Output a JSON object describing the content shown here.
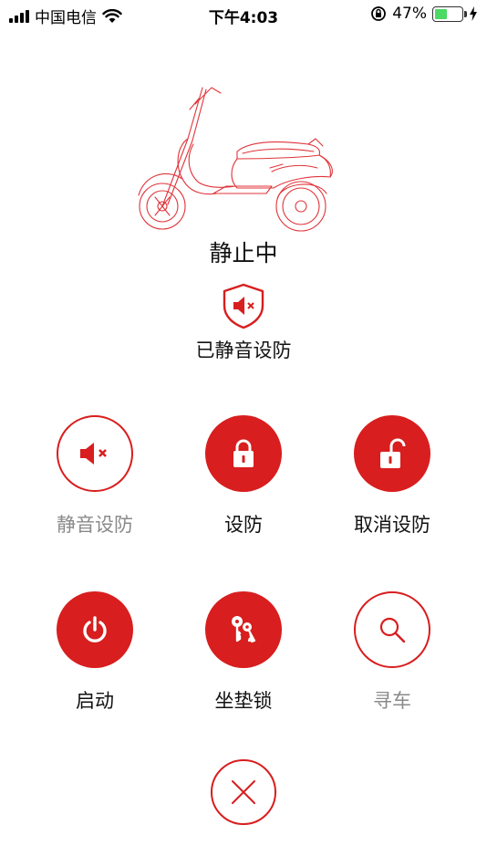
{
  "status_bar": {
    "carrier": "中国电信",
    "time": "下午4:03",
    "battery_percent": "47%",
    "battery_level": 0.47
  },
  "vehicle": {
    "state_label": "静止中",
    "image_icon": "scooter-illustration"
  },
  "arm_status": {
    "label": "已静音设防",
    "icon": "shield-muted-icon"
  },
  "actions": [
    {
      "label": "静音设防",
      "icon": "speaker-mute-icon",
      "style": "outline",
      "enabled": false
    },
    {
      "label": "设防",
      "icon": "lock-closed-icon",
      "style": "filled",
      "enabled": true
    },
    {
      "label": "取消设防",
      "icon": "lock-open-icon",
      "style": "filled",
      "enabled": true
    },
    {
      "label": "启动",
      "icon": "power-icon",
      "style": "filled",
      "enabled": true
    },
    {
      "label": "坐垫锁",
      "icon": "keys-icon",
      "style": "filled",
      "enabled": true
    },
    {
      "label": "寻车",
      "icon": "search-icon",
      "style": "outline",
      "enabled": false
    }
  ],
  "close": {
    "icon": "close-icon"
  },
  "colors": {
    "accent": "#d81e1e",
    "muted_text": "#8a8a8a",
    "battery": "#4cd964"
  }
}
